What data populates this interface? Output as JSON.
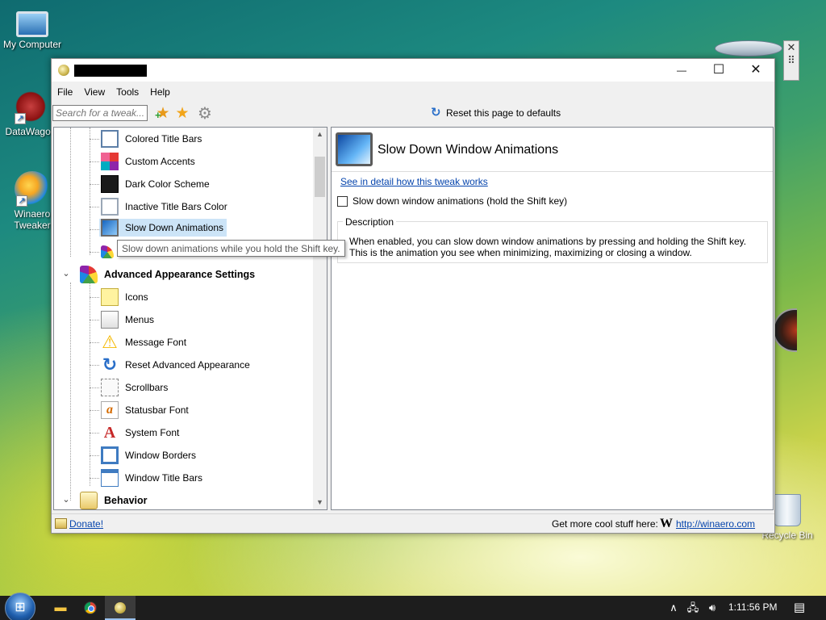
{
  "desktop": {
    "icons": [
      {
        "label": "My Computer"
      },
      {
        "label": "DataWagon"
      },
      {
        "label": "Winaero\nTweaker",
        "line1": "Winaero",
        "line2": "Tweaker"
      },
      {
        "label": "Recycle Bin"
      }
    ]
  },
  "window": {
    "title": "",
    "controls": {
      "minimize": "—",
      "maximize": "☐",
      "close": "✕"
    },
    "menu": [
      "File",
      "View",
      "Tools",
      "Help"
    ],
    "toolbar": {
      "search_placeholder": "Search for a tweak...",
      "reset_label": "Reset this page to defaults"
    },
    "tree": {
      "items_top": [
        {
          "label": "Colored Title Bars",
          "icon": "colored-title-bars-icon"
        },
        {
          "label": "Custom Accents",
          "icon": "custom-accents-icon"
        },
        {
          "label": "Dark Color Scheme",
          "icon": "dark-color-scheme-icon"
        },
        {
          "label": "Inactive Title Bars Color",
          "icon": "inactive-title-bars-icon"
        },
        {
          "label": "Slow Down Animations",
          "icon": "slow-down-animations-icon",
          "selected": true
        }
      ],
      "group_advanced": {
        "label": "Advanced Appearance Settings",
        "expander": "⌄"
      },
      "items_advanced": [
        {
          "label": "Icons",
          "icon": "icons-icon"
        },
        {
          "label": "Menus",
          "icon": "menus-icon"
        },
        {
          "label": "Message Font",
          "icon": "warning-icon"
        },
        {
          "label": "Reset Advanced Appearance",
          "icon": "reset-icon"
        },
        {
          "label": "Scrollbars",
          "icon": "scrollbars-icon"
        },
        {
          "label": "Statusbar Font",
          "icon": "statusbar-font-icon"
        },
        {
          "label": "System Font",
          "icon": "system-font-icon"
        },
        {
          "label": "Window Borders",
          "icon": "window-borders-icon"
        },
        {
          "label": "Window Title Bars",
          "icon": "window-title-bars-icon"
        }
      ],
      "group_behavior": {
        "label": "Behavior",
        "expander": "⌄"
      },
      "tooltip": "Slow down animations while you hold the Shift key."
    },
    "detail": {
      "title": "Slow Down Window Animations",
      "link": "See in detail how this tweak works",
      "checkbox_label": "Slow down window animations (hold the Shift key)",
      "checked": false,
      "description_legend": "Description",
      "description": "When enabled, you can slow down window animations by pressing and holding the Shift key. This is the animation you see when minimizing, maximizing or closing a window."
    },
    "statusbar": {
      "donate": "Donate!",
      "get_more": "Get more cool stuff here:",
      "logo": "W",
      "url": "http://winaero.com"
    }
  },
  "taskbar": {
    "clock": "1:11:56 PM",
    "tray_icons": [
      "chevron-up-icon",
      "network-icon",
      "volume-icon"
    ],
    "apps": [
      "file-explorer-icon",
      "chrome-icon",
      "winaero-tweaker-icon"
    ]
  }
}
